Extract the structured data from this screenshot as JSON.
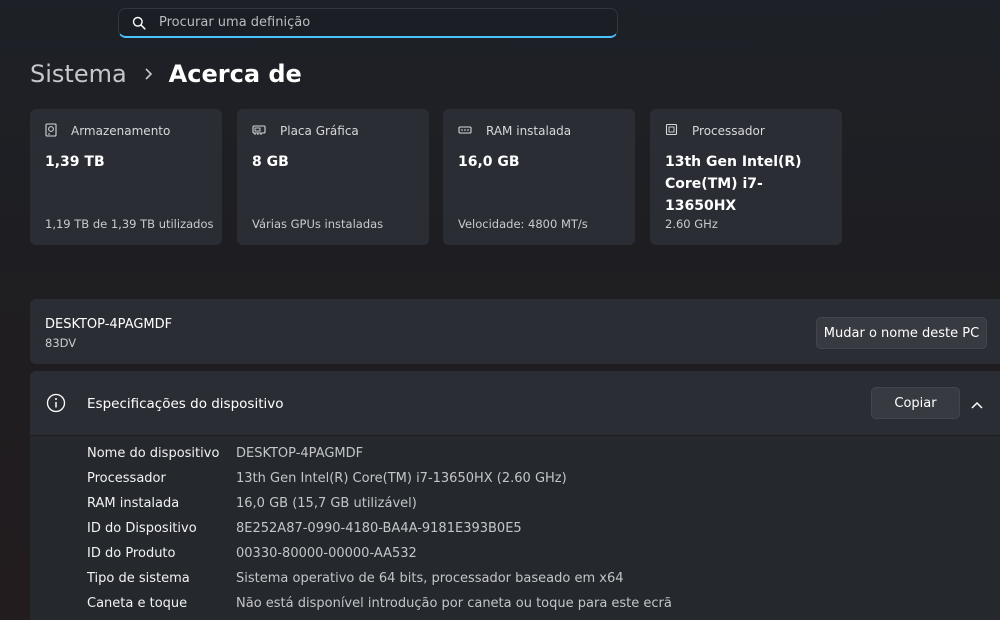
{
  "search": {
    "placeholder": "Procurar uma definição"
  },
  "breadcrumb": {
    "parent": "Sistema",
    "current": "Acerca de"
  },
  "cards": [
    {
      "icon": "storage-icon",
      "title": "Armazenamento",
      "value": "1,39 TB",
      "sub": "1,19 TB de 1,39 TB utilizados"
    },
    {
      "icon": "graphics-card-icon",
      "title": "Placa Gráfica",
      "value": "8 GB",
      "sub": "Várias GPUs instaladas"
    },
    {
      "icon": "ram-icon",
      "title": "RAM instalada",
      "value": "16,0 GB",
      "sub": "Velocidade: 4800 MT/s"
    },
    {
      "icon": "processor-icon",
      "title": "Processador",
      "value": "13th Gen Intel(R) Core(TM) i7-13650HX",
      "sub": "2.60 GHz"
    }
  ],
  "device": {
    "name": "DESKTOP-4PAGMDF",
    "model": "83DV",
    "rename_label": "Mudar o nome deste PC"
  },
  "specs": {
    "title": "Especificações do dispositivo",
    "copy_label": "Copiar",
    "rows": [
      {
        "label": "Nome do dispositivo",
        "value": "DESKTOP-4PAGMDF"
      },
      {
        "label": "Processador",
        "value": "13th Gen Intel(R) Core(TM) i7-13650HX (2.60 GHz)"
      },
      {
        "label": "RAM instalada",
        "value": "16,0 GB (15,7 GB utilizável)"
      },
      {
        "label": "ID do Dispositivo",
        "value": "8E252A87-0990-4180-BA4A-9181E393B0E5"
      },
      {
        "label": "ID do Produto",
        "value": "00330-80000-00000-AA532"
      },
      {
        "label": "Tipo de sistema",
        "value": "Sistema operativo de 64 bits, processador baseado em x64"
      },
      {
        "label": "Caneta e toque",
        "value": "Não está disponível introdução por caneta ou toque para este ecrã"
      }
    ]
  },
  "colors": {
    "accent": "#4cc2ff",
    "card": "#2a2e34",
    "background": "#1f2126"
  }
}
